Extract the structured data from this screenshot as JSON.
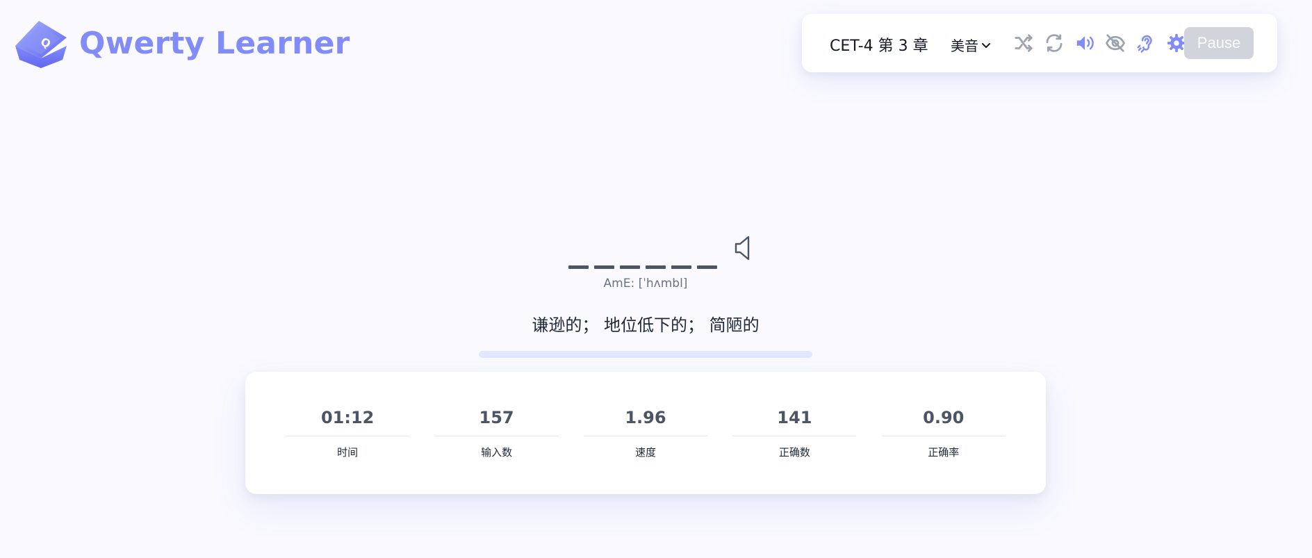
{
  "app": {
    "title": "Qwerty Learner"
  },
  "toolbar": {
    "dictionary": "CET-4 第 3 章",
    "accent": "美音",
    "icons": [
      "shuffle-icon",
      "loop-icon",
      "sound-icon",
      "hide-eye-icon",
      "listen-icon",
      "settings-icon"
    ],
    "pause_label": "Pause"
  },
  "word": {
    "letter_count": 6,
    "phonetic": "AmE: [ˈhʌmbl]",
    "translation": "谦逊的； 地位低下的； 简陋的"
  },
  "stats": [
    {
      "value": "01:12",
      "label": "时间"
    },
    {
      "value": "157",
      "label": "输入数"
    },
    {
      "value": "1.96",
      "label": "速度"
    },
    {
      "value": "141",
      "label": "正确数"
    },
    {
      "value": "0.90",
      "label": "正确率"
    }
  ],
  "colors": {
    "accent": "#818cf8",
    "icon_gray": "#9ca3af",
    "pause_bg": "#d1d5db",
    "progress_track": "#e0e7ff"
  }
}
